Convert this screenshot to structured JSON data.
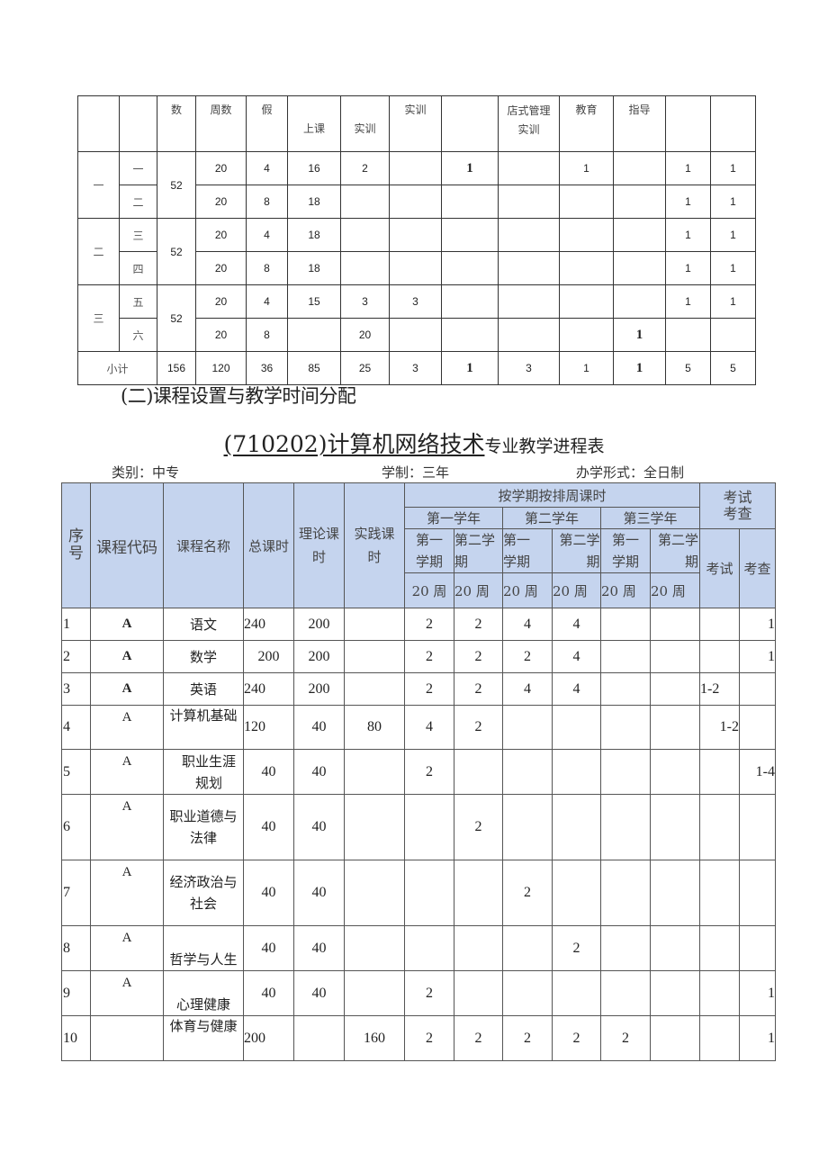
{
  "top_table": {
    "header": [
      "",
      "",
      "数",
      "周数",
      "假",
      "上课",
      "实训",
      "实训",
      "",
      "店式管理实训",
      "教育",
      "指导",
      "",
      ""
    ],
    "groups": [
      {
        "year": "一",
        "total": "52",
        "rows": [
          {
            "term": "一",
            "cells": [
              "20",
              "4",
              "16",
              "2",
              "",
              "1",
              "",
              "1",
              "",
              "1",
              "1"
            ]
          },
          {
            "term": "二",
            "cells": [
              "20",
              "8",
              "18",
              "",
              "",
              "",
              "",
              "",
              "",
              "1",
              "1"
            ]
          }
        ]
      },
      {
        "year": "二",
        "total": "52",
        "rows": [
          {
            "term": "三",
            "cells": [
              "20",
              "4",
              "18",
              "",
              "",
              "",
              "",
              "",
              "",
              "1",
              "1"
            ]
          },
          {
            "term": "四",
            "cells": [
              "20",
              "8",
              "18",
              "",
              "",
              "",
              "",
              "",
              "",
              "1",
              "1"
            ]
          }
        ]
      },
      {
        "year": "三",
        "total": "52",
        "rows": [
          {
            "term": "五",
            "cells": [
              "20",
              "4",
              "15",
              "3",
              "3",
              "",
              "",
              "",
              "",
              "1",
              "1"
            ]
          },
          {
            "term": "六",
            "cells": [
              "20",
              "8",
              "",
              "20",
              "",
              "",
              "",
              "",
              "1",
              "",
              ""
            ]
          }
        ]
      }
    ],
    "subtotal": {
      "label": "小计",
      "cells": [
        "156",
        "120",
        "36",
        "85",
        "25",
        "3",
        "1",
        "3",
        "1",
        "1",
        "5",
        "5"
      ]
    }
  },
  "section_heading": "(二)课程设置与教学时间分配",
  "main_title": {
    "underlined": "(710202)计算机网络技术",
    "rest": "专业教学进程表"
  },
  "meta": {
    "category": "类别：中专",
    "duration": "学制：三年",
    "mode": "办学形式：全日制"
  },
  "main_table": {
    "headers": {
      "index": "序号",
      "code": "课程代码",
      "name": "课程名称",
      "total_hours": "总课时",
      "theory_hours": "理论课时",
      "practice_hours": "实践课时",
      "weekly_hours": "按学期按排周课时",
      "exam_group": "考试考查",
      "years": [
        "第一学年",
        "第二学年",
        "第三学年"
      ],
      "terms": [
        "第一学期",
        "第二学期",
        "第一学期",
        "第二学期",
        "第一学期",
        "第二学期"
      ],
      "weeks": [
        "20 周",
        "20 周",
        "20 周",
        "20 周",
        "20 周",
        "20 周"
      ],
      "exam": "考试",
      "check": "考查"
    },
    "rows": [
      {
        "index": "1",
        "code": "A",
        "name": "语文",
        "total": "240",
        "theory": "200",
        "practice": "",
        "terms": [
          "2",
          "2",
          "4",
          "4",
          "",
          ""
        ],
        "exam": "",
        "check": "1"
      },
      {
        "index": "2",
        "code": "A",
        "name": "数学",
        "total": "200",
        "theory": "200",
        "practice": "",
        "terms": [
          "2",
          "2",
          "2",
          "4",
          "",
          ""
        ],
        "exam": "",
        "check": "1"
      },
      {
        "index": "3",
        "code": "A",
        "name": "英语",
        "total": "240",
        "theory": "200",
        "practice": "",
        "terms": [
          "2",
          "2",
          "4",
          "4",
          "",
          ""
        ],
        "exam": "1-2",
        "check": ""
      },
      {
        "index": "4",
        "code": "A",
        "name": "计算机基础",
        "total": "120",
        "theory": "40",
        "practice": "80",
        "terms": [
          "4",
          "2",
          "",
          "",
          "",
          ""
        ],
        "exam": "1-2",
        "check": ""
      },
      {
        "index": "5",
        "code": "A",
        "name": "职业生涯规划",
        "total": "40",
        "theory": "40",
        "practice": "",
        "terms": [
          "2",
          "",
          "",
          "",
          "",
          ""
        ],
        "exam": "",
        "check": "1-4"
      },
      {
        "index": "6",
        "code": "A",
        "name": "职业道德与法律",
        "total": "40",
        "theory": "40",
        "practice": "",
        "terms": [
          "",
          "2",
          "",
          "",
          "",
          ""
        ],
        "exam": "",
        "check": ""
      },
      {
        "index": "7",
        "code": "A",
        "name": "经济政治与社会",
        "total": "40",
        "theory": "40",
        "practice": "",
        "terms": [
          "",
          "",
          "2",
          "",
          "",
          ""
        ],
        "exam": "",
        "check": ""
      },
      {
        "index": "8",
        "code": "A",
        "name": "哲学与人生",
        "total": "40",
        "theory": "40",
        "practice": "",
        "terms": [
          "",
          "",
          "",
          "2",
          "",
          ""
        ],
        "exam": "",
        "check": ""
      },
      {
        "index": "9",
        "code": "A",
        "name": "心理健康",
        "total": "40",
        "theory": "40",
        "practice": "",
        "terms": [
          "2",
          "",
          "",
          "",
          "",
          ""
        ],
        "exam": "",
        "check": "1"
      },
      {
        "index": "10",
        "code": "",
        "name": "体育与健康",
        "total": "200",
        "theory": "",
        "practice": "160",
        "terms": [
          "2",
          "2",
          "2",
          "2",
          "2",
          ""
        ],
        "exam": "",
        "check": "1"
      }
    ]
  },
  "colors": {
    "header_bg": "#c5d4ee",
    "border": "#333333"
  }
}
